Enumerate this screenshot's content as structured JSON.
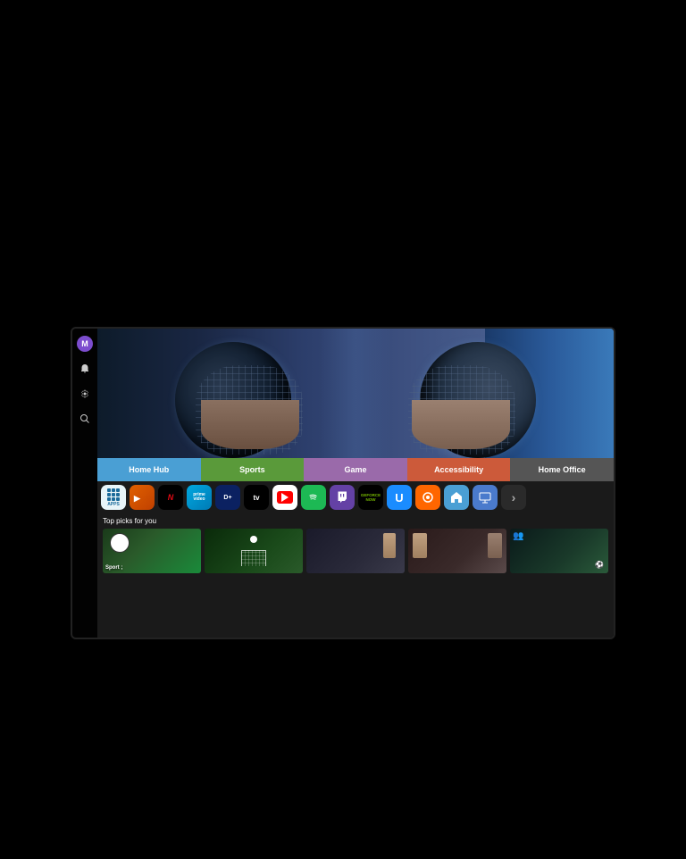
{
  "page": {
    "background": "#000000"
  },
  "sidebar": {
    "avatar_label": "M",
    "items": [
      {
        "name": "avatar",
        "label": "M",
        "icon": "user-icon"
      },
      {
        "name": "notifications",
        "icon": "bell-icon"
      },
      {
        "name": "settings",
        "icon": "settings-icon"
      },
      {
        "name": "search",
        "icon": "search-icon"
      }
    ]
  },
  "nav_tabs": [
    {
      "id": "home-hub",
      "label": "Home Hub",
      "active": true
    },
    {
      "id": "sports",
      "label": "Sports",
      "active": false
    },
    {
      "id": "game",
      "label": "Game",
      "active": false
    },
    {
      "id": "accessibility",
      "label": "Accessibility",
      "active": false
    },
    {
      "id": "home-office",
      "label": "Home Office",
      "active": false
    }
  ],
  "apps": [
    {
      "id": "all-apps",
      "label": "APPS",
      "type": "apps"
    },
    {
      "id": "viaplay",
      "label": "V",
      "type": "viaplay"
    },
    {
      "id": "netflix",
      "label": "NETFLIX",
      "type": "netflix"
    },
    {
      "id": "prime",
      "label": "prime video",
      "type": "prime"
    },
    {
      "id": "disney",
      "label": "Disney+",
      "type": "disney"
    },
    {
      "id": "appletv",
      "label": "tv",
      "type": "appletv"
    },
    {
      "id": "youtube",
      "label": "YouTube",
      "type": "youtube"
    },
    {
      "id": "spotify",
      "label": "Spotify",
      "type": "spotify"
    },
    {
      "id": "twitch",
      "label": "twitch",
      "type": "twitch"
    },
    {
      "id": "geforce",
      "label": "GEFORCE NOW",
      "type": "geforce"
    },
    {
      "id": "uplay",
      "label": "U",
      "type": "uplay"
    },
    {
      "id": "circle",
      "label": "◎",
      "type": "circle"
    },
    {
      "id": "home-app",
      "label": "⌂",
      "type": "home"
    },
    {
      "id": "monitor",
      "label": "▭",
      "type": "monitor"
    },
    {
      "id": "more",
      "label": "›",
      "type": "more"
    }
  ],
  "top_picks": {
    "label": "Top picks for you",
    "items": [
      {
        "id": "pick1",
        "theme": "soccer",
        "label": "Sport ;"
      },
      {
        "id": "pick2",
        "theme": "goal"
      },
      {
        "id": "pick3",
        "theme": "handball"
      },
      {
        "id": "pick4",
        "theme": "boxing"
      },
      {
        "id": "pick5",
        "theme": "football"
      }
    ]
  }
}
